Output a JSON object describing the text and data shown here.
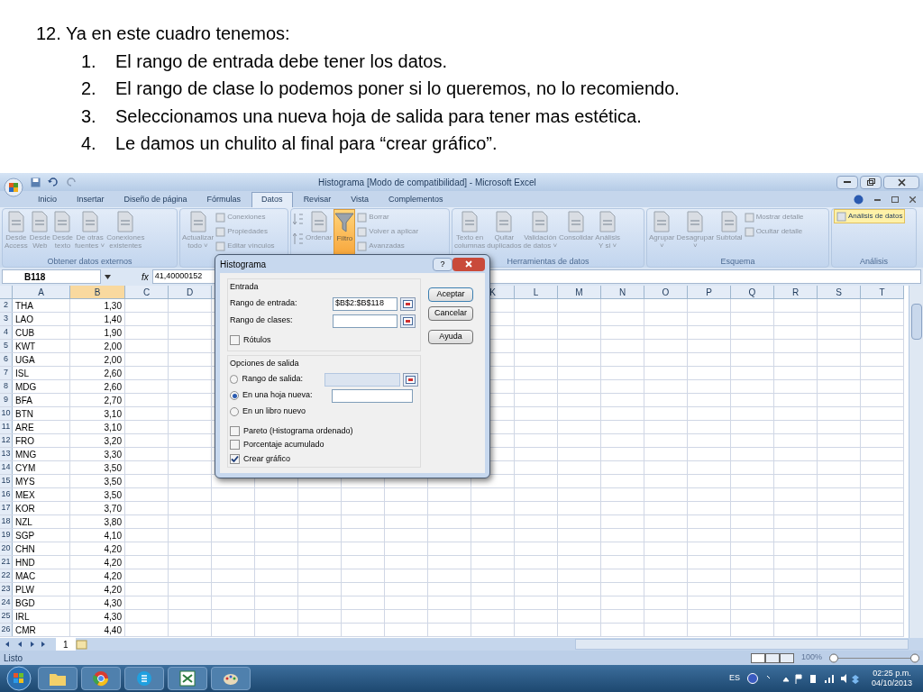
{
  "slide": {
    "heading": "12. Ya en este cuadro tenemos:",
    "steps": [
      {
        "number": "1.",
        "text": "El rango de entrada debe tener los datos."
      },
      {
        "number": "2.",
        "text": "El rango de clase lo podemos poner si lo queremos, no lo recomiendo."
      },
      {
        "number": "3.",
        "text": "Seleccionamos una nueva hoja de salida para tener mas estética."
      },
      {
        "number": "4.",
        "text": "Le damos un chulito al final para “crear gráfico”."
      }
    ]
  },
  "window": {
    "title": "Histograma  [Modo de compatibilidad] - Microsoft Excel"
  },
  "tabs": [
    {
      "label": "Inicio",
      "selected": false
    },
    {
      "label": "Insertar",
      "selected": false
    },
    {
      "label": "Diseño de página",
      "selected": false
    },
    {
      "label": "Fórmulas",
      "selected": false
    },
    {
      "label": "Datos",
      "selected": true
    },
    {
      "label": "Revisar",
      "selected": false
    },
    {
      "label": "Vista",
      "selected": false
    },
    {
      "label": "Complementos",
      "selected": false
    }
  ],
  "ribbon": [
    {
      "label": "Obtener datos externos",
      "items": [
        {
          "kind": "large",
          "label": "Desde\nAccess",
          "highlighted": false
        },
        {
          "kind": "large",
          "label": "Desde\nWeb",
          "highlighted": false
        },
        {
          "kind": "large",
          "label": "Desde\ntexto",
          "highlighted": false
        },
        {
          "kind": "large",
          "label": "De otras\nfuentes ˅",
          "highlighted": false
        },
        {
          "kind": "large",
          "label": "Conexiones\nexistentes",
          "highlighted": false
        }
      ]
    },
    {
      "items": [
        {
          "kind": "large",
          "label": "Actualizar\ntodo ˅",
          "highlighted": false
        },
        {
          "kind": "stack",
          "labels": [
            "Conexiones",
            "Propiedades",
            "Editar vínculos"
          ]
        }
      ]
    },
    {
      "items": [
        {
          "kind": "sort"
        },
        {
          "kind": "large",
          "label": "Ordenar",
          "highlighted": false
        },
        {
          "kind": "large",
          "label": "Filtro",
          "highlighted": true
        },
        {
          "kind": "stack",
          "labels": [
            "Borrar",
            "Volver a aplicar",
            "Avanzadas"
          ]
        }
      ]
    },
    {
      "label": "Herramientas de datos",
      "items": [
        {
          "kind": "large",
          "label": "Texto en\ncolumnas",
          "highlighted": false
        },
        {
          "kind": "large",
          "label": "Quitar\nduplicados",
          "highlighted": false
        },
        {
          "kind": "large",
          "label": "Validación\nde datos ˅",
          "highlighted": false
        },
        {
          "kind": "large",
          "label": "Consolidar",
          "highlighted": false
        },
        {
          "kind": "large",
          "label": "Análisis\nY si ˅",
          "highlighted": false
        }
      ]
    },
    {
      "label": "Esquema",
      "items": [
        {
          "kind": "large",
          "label": "Agrupar\n˅",
          "highlighted": false
        },
        {
          "kind": "large",
          "label": "Desagrupar\n˅",
          "highlighted": false
        },
        {
          "kind": "large",
          "label": "Subtotal",
          "highlighted": false
        },
        {
          "kind": "stack",
          "labels": [
            "Mostrar detalle",
            "Ocultar detalle"
          ]
        }
      ]
    },
    {
      "label": "Análisis",
      "items": [
        {
          "kind": "small",
          "label": "Análisis de datos",
          "highlighted": true
        }
      ]
    }
  ],
  "formula_bar": {
    "name_box": "B118",
    "fx": "fx",
    "value": "41,40000152"
  },
  "columns_left": [
    {
      "label": "A",
      "selected": false
    },
    {
      "label": "B",
      "selected": true
    },
    {
      "label": "C",
      "selected": false
    },
    {
      "label": "D",
      "selected": false
    }
  ],
  "columns_right": [
    {
      "label": "K",
      "selected": false
    },
    {
      "label": "L",
      "selected": false
    },
    {
      "label": "M",
      "selected": false
    },
    {
      "label": "N",
      "selected": false
    },
    {
      "label": "O",
      "selected": false
    },
    {
      "label": "P",
      "selected": false
    },
    {
      "label": "Q",
      "selected": false
    },
    {
      "label": "R",
      "selected": false
    },
    {
      "label": "S",
      "selected": false
    },
    {
      "label": "T",
      "selected": false
    }
  ],
  "rows": [
    {
      "number": "2",
      "code": "THA",
      "value": "1,30"
    },
    {
      "number": "3",
      "code": "LAO",
      "value": "1,40"
    },
    {
      "number": "4",
      "code": "CUB",
      "value": "1,90"
    },
    {
      "number": "5",
      "code": "KWT",
      "value": "2,00"
    },
    {
      "number": "6",
      "code": "UGA",
      "value": "2,00"
    },
    {
      "number": "7",
      "code": "ISL",
      "value": "2,60"
    },
    {
      "number": "8",
      "code": "MDG",
      "value": "2,60"
    },
    {
      "number": "9",
      "code": "BFA",
      "value": "2,70"
    },
    {
      "number": "10",
      "code": "BTN",
      "value": "3,10"
    },
    {
      "number": "11",
      "code": "ARE",
      "value": "3,10"
    },
    {
      "number": "12",
      "code": "FRO",
      "value": "3,20"
    },
    {
      "number": "13",
      "code": "MNG",
      "value": "3,30"
    },
    {
      "number": "14",
      "code": "CYM",
      "value": "3,50"
    },
    {
      "number": "15",
      "code": "MYS",
      "value": "3,50"
    },
    {
      "number": "16",
      "code": "MEX",
      "value": "3,50"
    },
    {
      "number": "17",
      "code": "KOR",
      "value": "3,70"
    },
    {
      "number": "18",
      "code": "NZL",
      "value": "3,80"
    },
    {
      "number": "19",
      "code": "SGP",
      "value": "4,10"
    },
    {
      "number": "20",
      "code": "CHN",
      "value": "4,20"
    },
    {
      "number": "21",
      "code": "HND",
      "value": "4,20"
    },
    {
      "number": "22",
      "code": "MAC",
      "value": "4,20"
    },
    {
      "number": "23",
      "code": "PLW",
      "value": "4,20"
    },
    {
      "number": "24",
      "code": "BGD",
      "value": "4,30"
    },
    {
      "number": "25",
      "code": "IRL",
      "value": "4,30"
    },
    {
      "number": "26",
      "code": "CMR",
      "value": "4,40"
    }
  ],
  "sheet_tabs": [
    {
      "label": "1",
      "selected": true
    }
  ],
  "status_bar": {
    "text": "Listo",
    "zoom": "100%"
  },
  "dialog": {
    "title": "Histograma",
    "help": "?",
    "input_section": "Entrada",
    "fields": [
      {
        "label": "Rango de entrada:",
        "value": "$B$2:$B$118"
      },
      {
        "label": "Rango de clases:"
      }
    ],
    "labels_checkbox": {
      "label": "Rótulos",
      "checked": false
    },
    "output_section": "Opciones de salida",
    "outputs": [
      {
        "label": "Rango de salida:",
        "selected": false
      },
      {
        "label": "En una hoja nueva:",
        "selected": true
      },
      {
        "label": "En un libro nuevo",
        "selected": false
      }
    ],
    "options": [
      {
        "label": "Pareto (Histograma ordenado)",
        "checked": false
      },
      {
        "label": "Porcentaje acumulado",
        "checked": false
      },
      {
        "label": "Crear gráfico",
        "checked": true
      }
    ],
    "buttons": [
      "Aceptar",
      "Cancelar",
      "Ayuda"
    ]
  },
  "taskbar": {
    "language": "ES",
    "time": "02:25 p.m.",
    "date": "04/10/2013"
  }
}
